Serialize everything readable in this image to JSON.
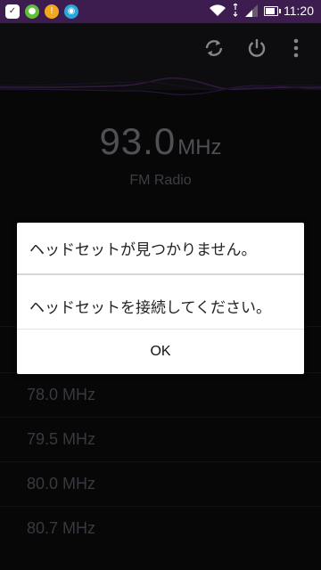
{
  "status_bar": {
    "time": "11:20",
    "left_icons": [
      "check-icon",
      "frog-icon",
      "warning-icon",
      "circle-app-icon"
    ],
    "right_icons": [
      "wifi-icon",
      "signal-icon",
      "battery-icon"
    ]
  },
  "toolbar": {
    "icons": [
      "refresh-icon",
      "power-icon",
      "more-vert-icon"
    ]
  },
  "radio": {
    "frequency": "93.0",
    "unit": "MHz",
    "label": "FM Radio"
  },
  "stations": [
    {
      "label": ""
    },
    {
      "label": "78.0 MHz"
    },
    {
      "label": "79.5 MHz"
    },
    {
      "label": "80.0 MHz"
    },
    {
      "label": "80.7 MHz"
    }
  ],
  "dialog": {
    "title": "ヘッドセットが見つかりません。",
    "message": "ヘッドセットを接続してください。",
    "ok_label": "OK"
  },
  "colors": {
    "status_bar": "#3d1d4f",
    "background": "#0b0b0d",
    "dialog_bg": "#ffffff"
  }
}
